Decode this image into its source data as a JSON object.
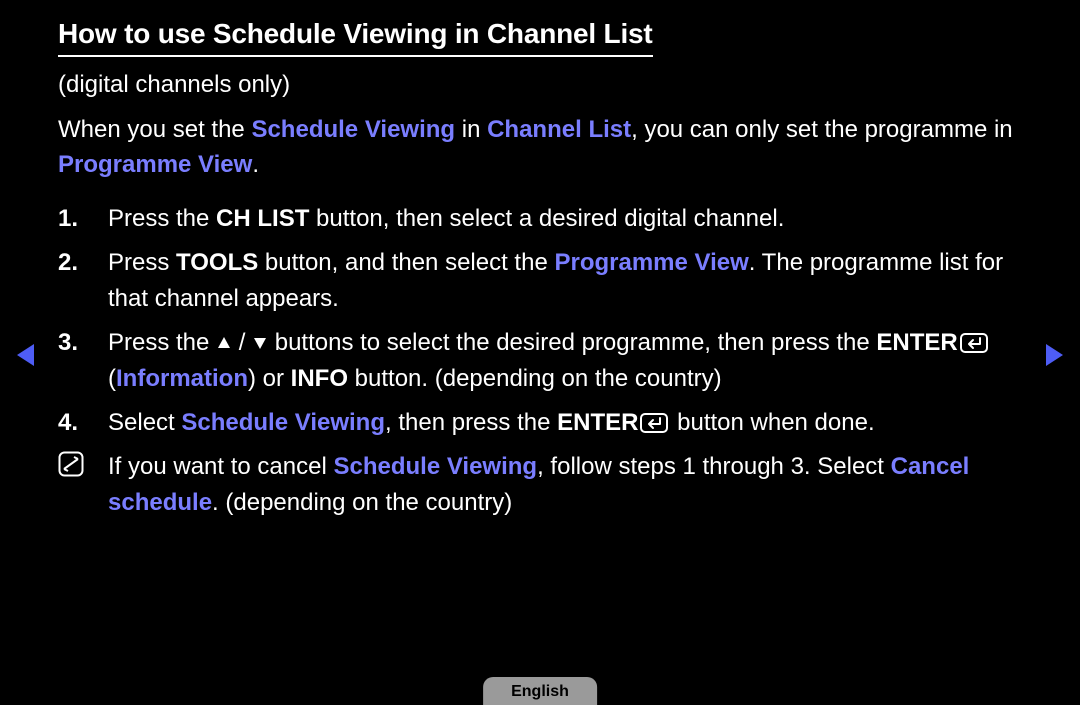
{
  "title": "How to use Schedule Viewing in Channel List",
  "subtitle": "(digital channels only)",
  "intro": {
    "t1": "When you set the ",
    "hl1": "Schedule Viewing",
    "t2": " in ",
    "hl2": "Channel List",
    "t3": ", you can only set the programme in ",
    "hl3": "Programme View",
    "t4": "."
  },
  "steps": {
    "s1": {
      "num": "1.",
      "a": "Press the ",
      "b1": "CH LIST",
      "c": " button, then select a desired digital channel."
    },
    "s2": {
      "num": "2.",
      "a": "Press ",
      "b1": "TOOLS",
      "c": " button, and then select the ",
      "hl1": "Programme View",
      "d": ". The programme list for that channel appears."
    },
    "s3": {
      "num": "3.",
      "a": "Press the ",
      "mid1": " / ",
      "b": " buttons to select the desired programme, then press the ",
      "enter": "ENTER",
      "c": " (",
      "hl1": "Information",
      "d": ") or ",
      "info": "INFO",
      "e": " button. (depending on the country)"
    },
    "s4": {
      "num": "4.",
      "a": "Select ",
      "hl1": "Schedule Viewing",
      "b": ", then press the ",
      "enter": "ENTER",
      "c": " button when done."
    },
    "note": {
      "a": "If you want to cancel ",
      "hl1": "Schedule Viewing",
      "b": ", follow steps 1 through 3. Select ",
      "hl2": "Cancel schedule",
      "c": ". (depending on the country)"
    }
  },
  "lang": "English"
}
